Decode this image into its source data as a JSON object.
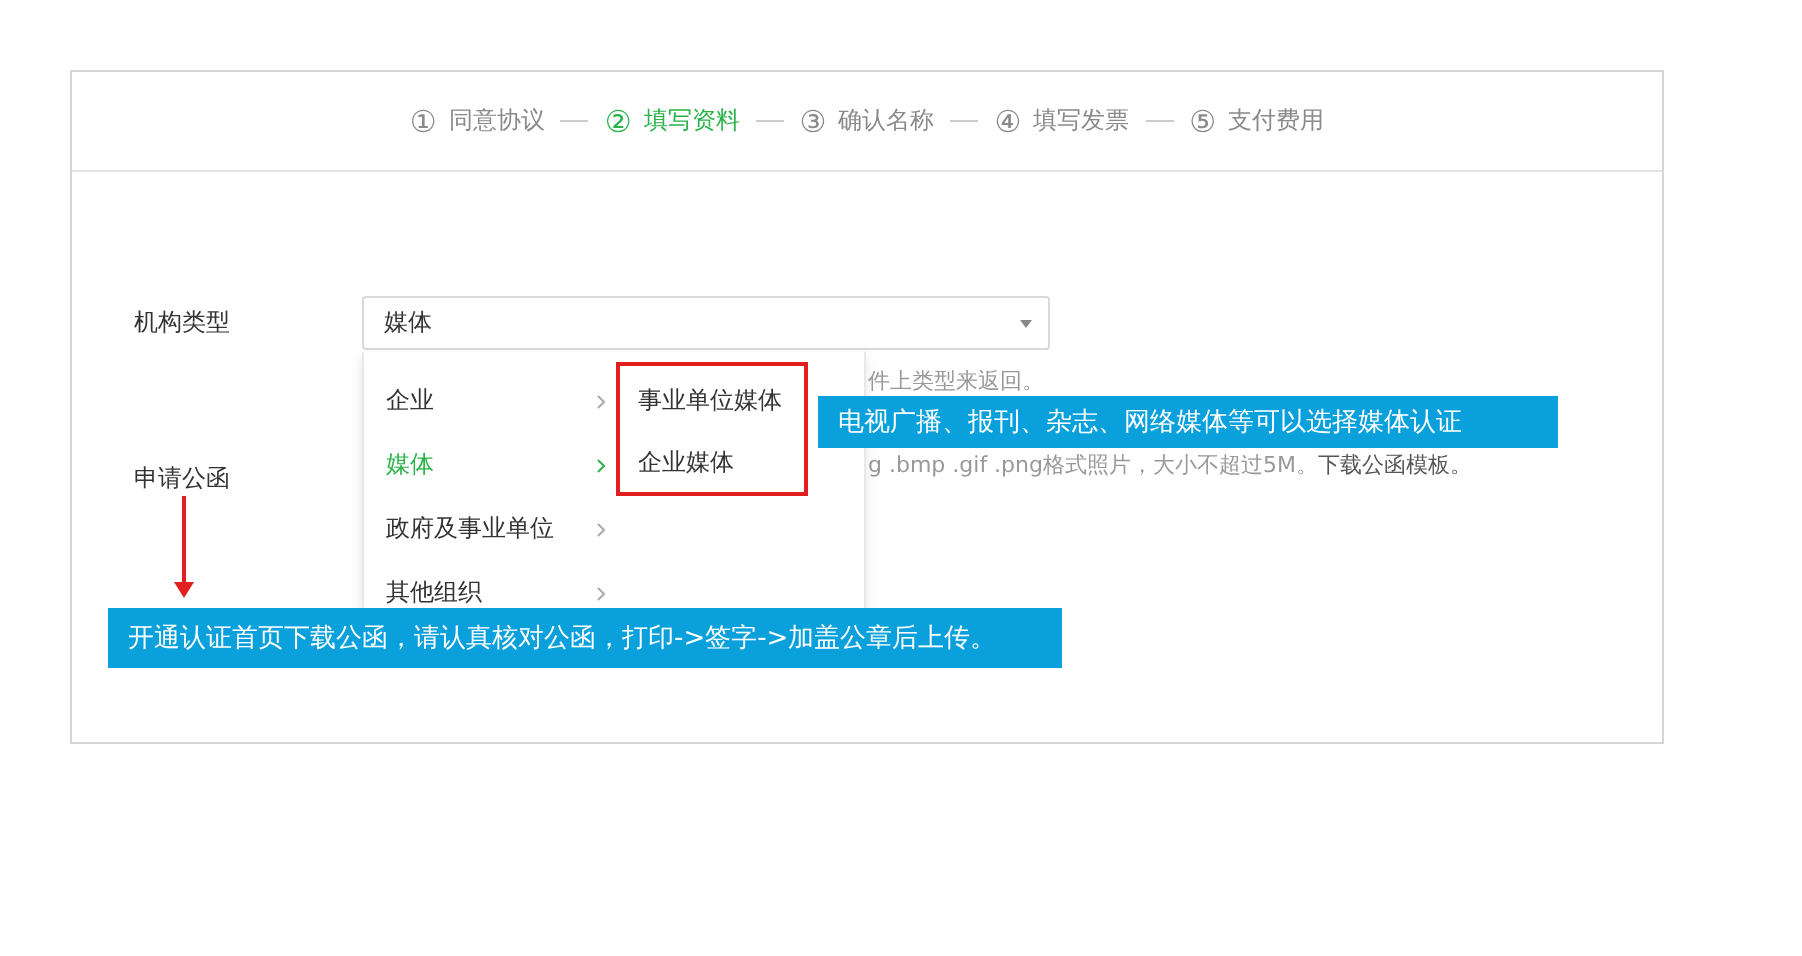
{
  "steps": [
    {
      "number": "①",
      "label": "同意协议",
      "selected": false
    },
    {
      "number": "②",
      "label": "填写资料",
      "selected": true
    },
    {
      "number": "③",
      "label": "确认名称",
      "selected": false
    },
    {
      "number": "④",
      "label": "填写发票",
      "selected": false
    },
    {
      "number": "⑤",
      "label": "支付费用",
      "selected": false
    }
  ],
  "form": {
    "type_label": "机构类型",
    "select_value": "媒体",
    "letter_label": "申请公函",
    "hint_1": "件上类型来返回。",
    "hint_2": "g .bmp .gif .png格式照片，大小不超过5M。",
    "template_link": "下载公函模板。"
  },
  "dropdown": {
    "items": [
      {
        "label": "企业",
        "selected": false
      },
      {
        "label": "媒体",
        "selected": true
      },
      {
        "label": "政府及事业单位",
        "selected": false
      },
      {
        "label": "其他组织",
        "selected": false
      }
    ],
    "submenu": [
      "事业单位媒体",
      "企业媒体"
    ]
  },
  "annotations": [
    {
      "text": "电视广播、报刊、杂志、网络媒体等可以选择媒体认证"
    },
    {
      "text": "开通认证首页下载公函，请认真核对公函，打印->签字->加盖公章后上传。"
    }
  ]
}
